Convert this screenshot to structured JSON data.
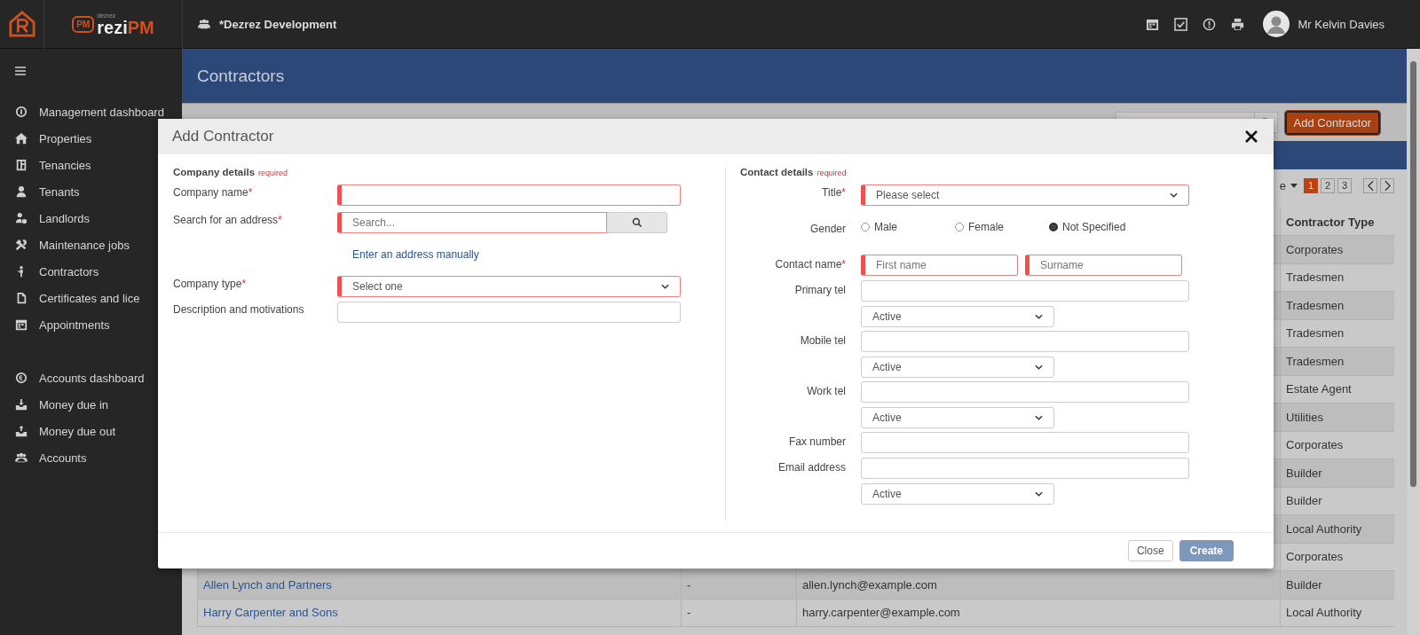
{
  "topbar": {
    "logo_badge": "PM",
    "logo_brand": "dezrez",
    "logo_main": "rezi",
    "logo_accent": "PM",
    "workspace": "*Dezrez Development",
    "user": "Mr Kelvin Davies"
  },
  "sidebar": {
    "groups": [
      [
        {
          "label": "Management dashboard"
        },
        {
          "label": "Properties"
        },
        {
          "label": "Tenancies"
        },
        {
          "label": "Tenants"
        },
        {
          "label": "Landlords"
        },
        {
          "label": "Maintenance jobs"
        },
        {
          "label": "Contractors"
        },
        {
          "label": "Certificates and lice"
        },
        {
          "label": "Appointments"
        }
      ],
      [
        {
          "label": "Accounts dashboard"
        },
        {
          "label": "Money due in"
        },
        {
          "label": "Money due out"
        },
        {
          "label": "Accounts"
        }
      ]
    ]
  },
  "page": {
    "title": "Contractors",
    "add_button": "Add Contractor"
  },
  "pagination": {
    "page_size_label": "e",
    "pages": [
      {
        "label": "1",
        "selected": true
      },
      {
        "label": "2",
        "selected": false
      },
      {
        "label": "3",
        "selected": false
      }
    ]
  },
  "table": {
    "columns": [
      {
        "label": "Contractor Type"
      }
    ],
    "rows": [
      {
        "type": "Corporates"
      },
      {
        "type": "Tradesmen"
      },
      {
        "type": "Tradesmen"
      },
      {
        "type": "Tradesmen"
      },
      {
        "type": "Tradesmen"
      },
      {
        "type": "Estate Agent"
      },
      {
        "type": "Utilities"
      },
      {
        "type": "Corporates"
      },
      {
        "type": "Builder"
      },
      {
        "type": "Builder"
      },
      {
        "type": "Local Authority"
      },
      {
        "type": "Corporates"
      },
      {
        "name": "Allen Lynch and Partners",
        "column_2": "-",
        "email": "allen.lynch@example.com",
        "type": "Builder"
      },
      {
        "name": "Harry Carpenter and Sons",
        "column_2": "-",
        "email": "harry.carpenter@example.com",
        "type": "Local Authority"
      }
    ]
  },
  "modal": {
    "title": "Add Contractor",
    "required_mark": "*",
    "company": {
      "heading": "Company details",
      "note": "required",
      "fields": [
        {
          "kind": "text",
          "label": "Company name",
          "required": true
        },
        {
          "kind": "search",
          "label": "Search for an address",
          "required": true,
          "placeholder": "Search..."
        },
        {
          "kind": "link",
          "label": "Enter an address manually"
        },
        {
          "kind": "select",
          "label": "Company type",
          "required": true,
          "value": "Select one"
        },
        {
          "kind": "text",
          "label": "Description and motivations",
          "required": false
        }
      ]
    },
    "contact": {
      "heading": "Contact details",
      "note": "required",
      "fields": [
        {
          "kind": "select",
          "label": "Title",
          "required": true,
          "value": "Please select"
        },
        {
          "kind": "radio",
          "label": "Gender",
          "options": [
            {
              "label": "Male",
              "selected": false
            },
            {
              "label": "Female",
              "selected": false
            },
            {
              "label": "Not Specified",
              "selected": true
            }
          ]
        },
        {
          "kind": "name",
          "label": "Contact name",
          "required": true,
          "placeholders": [
            "First name",
            "Surname"
          ]
        },
        {
          "kind": "phone",
          "label": "Primary tel",
          "required": false,
          "status": "Active"
        },
        {
          "kind": "phone",
          "label": "Mobile tel",
          "required": false,
          "status": "Active"
        },
        {
          "kind": "phone",
          "label": "Work tel",
          "required": false,
          "status": "Active"
        },
        {
          "kind": "text",
          "label": "Fax number",
          "required": false
        },
        {
          "kind": "phone",
          "label": "Email address",
          "required": false,
          "status": "Active"
        }
      ]
    },
    "buttons": [
      {
        "label": "Close",
        "kind": "secondary"
      },
      {
        "label": "Create",
        "kind": "primary"
      }
    ]
  }
}
